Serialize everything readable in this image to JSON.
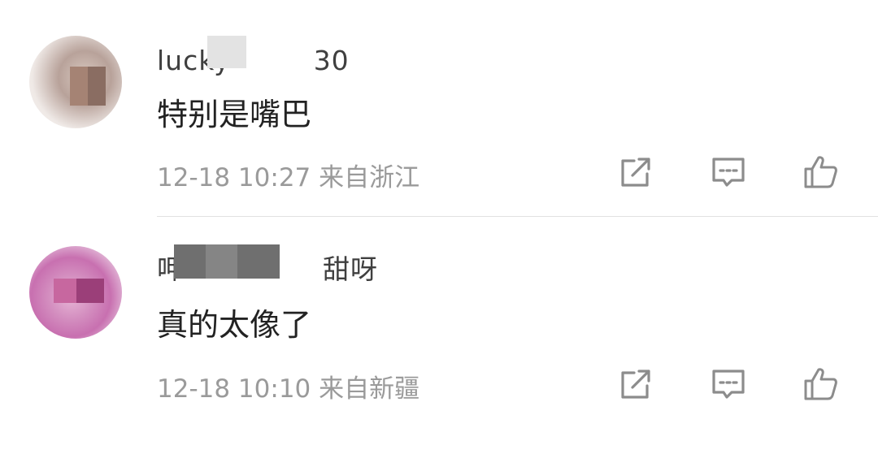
{
  "comments": [
    {
      "username": "lucky　　　30",
      "content": "特别是嘴巴",
      "timestamp": "12-18 10:27",
      "location": "来自浙江"
    },
    {
      "username": "呷　　　　　甜呀",
      "content": "真的太像了",
      "timestamp": "12-18 10:10",
      "location": "来自新疆"
    }
  ],
  "icons": {
    "share": "share-icon",
    "reply": "comment-icon",
    "like": "thumbs-up-icon"
  },
  "colors": {
    "text_primary": "#222222",
    "text_secondary": "#9a9a9a",
    "icon": "#8c8c8c",
    "divider": "#e2e2e2"
  }
}
